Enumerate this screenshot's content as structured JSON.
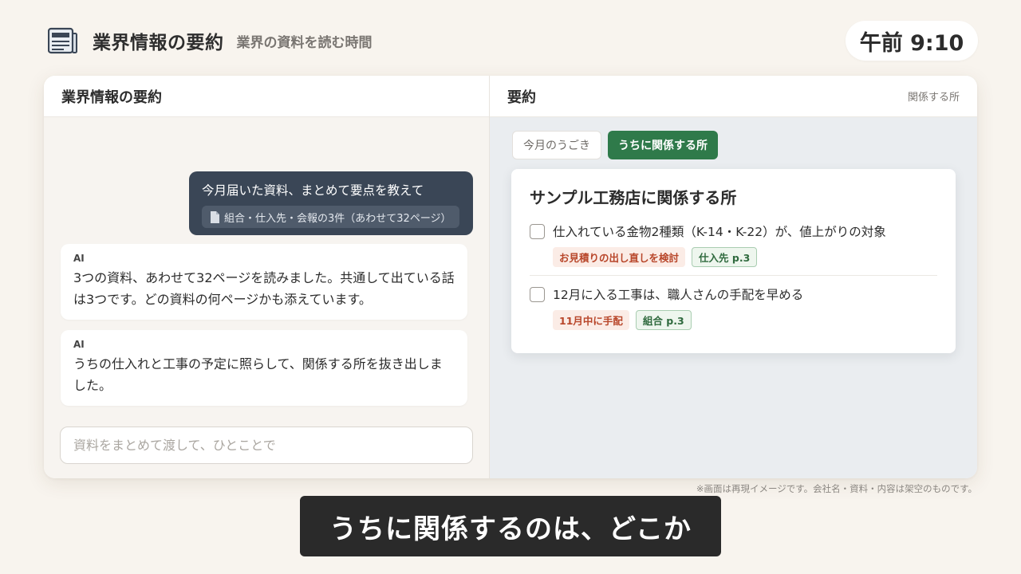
{
  "header": {
    "title": "業界情報の要約",
    "subtitle": "業界の資料を読む時間",
    "icon": "newspaper-icon"
  },
  "clock": {
    "time": "午前 9:10"
  },
  "chat_panel": {
    "title": "業界情報の要約",
    "user_message": {
      "text": "今月届いた資料、まとめて要点を教えて",
      "attachment": "組合・仕入先・会報の3件（あわせて32ページ）",
      "attachment_icon": "document-icon"
    },
    "ai_messages": [
      {
        "label": "AI",
        "text": "3つの資料、あわせて32ページを読みました。共通して出ている話は3つです。どの資料の何ページかも添えています。"
      },
      {
        "label": "AI",
        "text": "うちの仕入れと工事の予定に照らして、関係する所を抜き出しました。"
      }
    ],
    "input": {
      "placeholder": "資料をまとめて渡して、ひとことで",
      "value": ""
    }
  },
  "summary_panel": {
    "title": "要約",
    "aside": "関係する所",
    "tabs": [
      {
        "label": "今月のうごき",
        "active": false
      },
      {
        "label": "うちに関係する所",
        "active": true
      }
    ],
    "card": {
      "title": "サンプル工務店に関係する所",
      "items": [
        {
          "checked": false,
          "text": "仕入れている金物2種類（K-14・K-22）が、値上がりの対象",
          "tags": [
            {
              "label": "お見積りの出し直しを検討",
              "kind": "warn"
            },
            {
              "label": "仕入先 p.3",
              "kind": "source"
            }
          ]
        },
        {
          "checked": false,
          "text": "12月に入る工事は、職人さんの手配を早める",
          "tags": [
            {
              "label": "11月中に手配",
              "kind": "warn"
            },
            {
              "label": "組合 p.3",
              "kind": "source"
            }
          ]
        }
      ]
    }
  },
  "colors": {
    "accent_green": "#2f7a4a",
    "user_bubble": "#3a4656",
    "warn_text": "#b8462a",
    "background": "#f8f4ee"
  },
  "footer": {
    "disclaimer": "※画面は再現イメージです。会社名・資料・内容は架空のものです。",
    "caption": "うちに関係するのは、どこか"
  }
}
